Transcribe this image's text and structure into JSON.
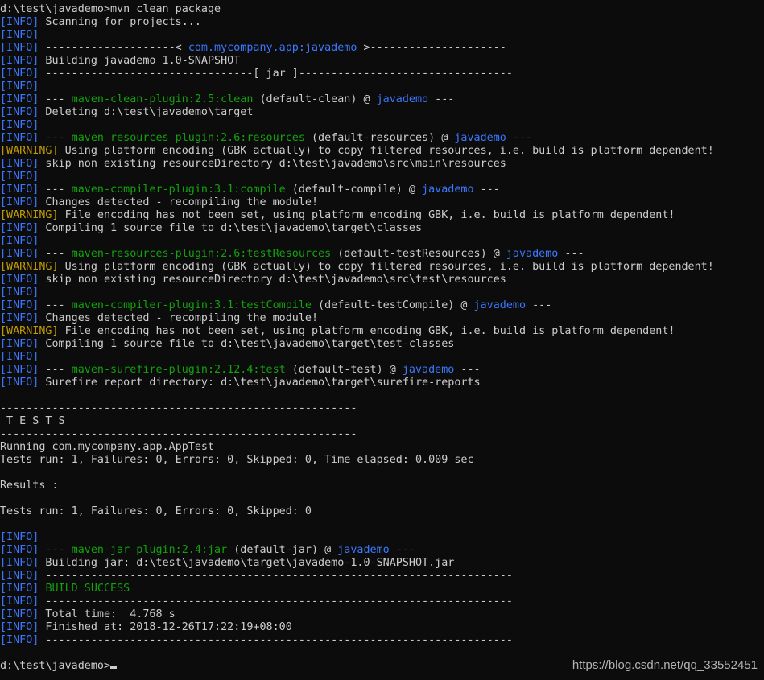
{
  "terminal": {
    "lines": [
      [
        {
          "t": "d:\\test\\javademo>mvn clean package",
          "c": "plain"
        }
      ],
      [
        {
          "t": "[INFO]",
          "c": "info"
        },
        {
          "t": " Scanning for projects...",
          "c": "plain"
        }
      ],
      [
        {
          "t": "[INFO]",
          "c": "info"
        }
      ],
      [
        {
          "t": "[INFO]",
          "c": "info"
        },
        {
          "t": " --------------------< ",
          "c": "plain"
        },
        {
          "t": "com.mycompany.app:javademo",
          "c": "project"
        },
        {
          "t": " >---------------------",
          "c": "plain"
        }
      ],
      [
        {
          "t": "[INFO]",
          "c": "info"
        },
        {
          "t": " Building javademo 1.0-SNAPSHOT",
          "c": "plain"
        }
      ],
      [
        {
          "t": "[INFO]",
          "c": "info"
        },
        {
          "t": " --------------------------------[ jar ]---------------------------------",
          "c": "plain"
        }
      ],
      [
        {
          "t": "[INFO]",
          "c": "info"
        }
      ],
      [
        {
          "t": "[INFO]",
          "c": "info"
        },
        {
          "t": " --- ",
          "c": "plain"
        },
        {
          "t": "maven-clean-plugin:2.5:clean",
          "c": "plugin"
        },
        {
          "t": " (default-clean) @ ",
          "c": "plain"
        },
        {
          "t": "javademo",
          "c": "project"
        },
        {
          "t": " ---",
          "c": "plain"
        }
      ],
      [
        {
          "t": "[INFO]",
          "c": "info"
        },
        {
          "t": " Deleting d:\\test\\javademo\\target",
          "c": "plain"
        }
      ],
      [
        {
          "t": "[INFO]",
          "c": "info"
        }
      ],
      [
        {
          "t": "[INFO]",
          "c": "info"
        },
        {
          "t": " --- ",
          "c": "plain"
        },
        {
          "t": "maven-resources-plugin:2.6:resources",
          "c": "plugin"
        },
        {
          "t": " (default-resources) @ ",
          "c": "plain"
        },
        {
          "t": "javademo",
          "c": "project"
        },
        {
          "t": " ---",
          "c": "plain"
        }
      ],
      [
        {
          "t": "[WARNING]",
          "c": "warning"
        },
        {
          "t": " Using platform encoding (GBK actually) to copy filtered resources, i.e. build is platform dependent!",
          "c": "plain"
        }
      ],
      [
        {
          "t": "[INFO]",
          "c": "info"
        },
        {
          "t": " skip non existing resourceDirectory d:\\test\\javademo\\src\\main\\resources",
          "c": "plain"
        }
      ],
      [
        {
          "t": "[INFO]",
          "c": "info"
        }
      ],
      [
        {
          "t": "[INFO]",
          "c": "info"
        },
        {
          "t": " --- ",
          "c": "plain"
        },
        {
          "t": "maven-compiler-plugin:3.1:compile",
          "c": "plugin"
        },
        {
          "t": " (default-compile) @ ",
          "c": "plain"
        },
        {
          "t": "javademo",
          "c": "project"
        },
        {
          "t": " ---",
          "c": "plain"
        }
      ],
      [
        {
          "t": "[INFO]",
          "c": "info"
        },
        {
          "t": " Changes detected - recompiling the module!",
          "c": "plain"
        }
      ],
      [
        {
          "t": "[WARNING]",
          "c": "warning"
        },
        {
          "t": " File encoding has not been set, using platform encoding GBK, i.e. build is platform dependent!",
          "c": "plain"
        }
      ],
      [
        {
          "t": "[INFO]",
          "c": "info"
        },
        {
          "t": " Compiling 1 source file to d:\\test\\javademo\\target\\classes",
          "c": "plain"
        }
      ],
      [
        {
          "t": "[INFO]",
          "c": "info"
        }
      ],
      [
        {
          "t": "[INFO]",
          "c": "info"
        },
        {
          "t": " --- ",
          "c": "plain"
        },
        {
          "t": "maven-resources-plugin:2.6:testResources",
          "c": "plugin"
        },
        {
          "t": " (default-testResources) @ ",
          "c": "plain"
        },
        {
          "t": "javademo",
          "c": "project"
        },
        {
          "t": " ---",
          "c": "plain"
        }
      ],
      [
        {
          "t": "[WARNING]",
          "c": "warning"
        },
        {
          "t": " Using platform encoding (GBK actually) to copy filtered resources, i.e. build is platform dependent!",
          "c": "plain"
        }
      ],
      [
        {
          "t": "[INFO]",
          "c": "info"
        },
        {
          "t": " skip non existing resourceDirectory d:\\test\\javademo\\src\\test\\resources",
          "c": "plain"
        }
      ],
      [
        {
          "t": "[INFO]",
          "c": "info"
        }
      ],
      [
        {
          "t": "[INFO]",
          "c": "info"
        },
        {
          "t": " --- ",
          "c": "plain"
        },
        {
          "t": "maven-compiler-plugin:3.1:testCompile",
          "c": "plugin"
        },
        {
          "t": " (default-testCompile) @ ",
          "c": "plain"
        },
        {
          "t": "javademo",
          "c": "project"
        },
        {
          "t": " ---",
          "c": "plain"
        }
      ],
      [
        {
          "t": "[INFO]",
          "c": "info"
        },
        {
          "t": " Changes detected - recompiling the module!",
          "c": "plain"
        }
      ],
      [
        {
          "t": "[WARNING]",
          "c": "warning"
        },
        {
          "t": " File encoding has not been set, using platform encoding GBK, i.e. build is platform dependent!",
          "c": "plain"
        }
      ],
      [
        {
          "t": "[INFO]",
          "c": "info"
        },
        {
          "t": " Compiling 1 source file to d:\\test\\javademo\\target\\test-classes",
          "c": "plain"
        }
      ],
      [
        {
          "t": "[INFO]",
          "c": "info"
        }
      ],
      [
        {
          "t": "[INFO]",
          "c": "info"
        },
        {
          "t": " --- ",
          "c": "plain"
        },
        {
          "t": "maven-surefire-plugin:2.12.4:test",
          "c": "plugin"
        },
        {
          "t": " (default-test) @ ",
          "c": "plain"
        },
        {
          "t": "javademo",
          "c": "project"
        },
        {
          "t": " ---",
          "c": "plain"
        }
      ],
      [
        {
          "t": "[INFO]",
          "c": "info"
        },
        {
          "t": " Surefire report directory: d:\\test\\javademo\\target\\surefire-reports",
          "c": "plain"
        }
      ],
      [],
      [
        {
          "t": "-------------------------------------------------------",
          "c": "plain"
        }
      ],
      [
        {
          "t": " T E S T S",
          "c": "plain"
        }
      ],
      [
        {
          "t": "-------------------------------------------------------",
          "c": "plain"
        }
      ],
      [
        {
          "t": "Running com.mycompany.app.AppTest",
          "c": "plain"
        }
      ],
      [
        {
          "t": "Tests run: 1, Failures: 0, Errors: 0, Skipped: 0, Time elapsed: 0.009 sec",
          "c": "plain"
        }
      ],
      [],
      [
        {
          "t": "Results :",
          "c": "plain"
        }
      ],
      [],
      [
        {
          "t": "Tests run: 1, Failures: 0, Errors: 0, Skipped: 0",
          "c": "plain"
        }
      ],
      [],
      [
        {
          "t": "[INFO]",
          "c": "info"
        }
      ],
      [
        {
          "t": "[INFO]",
          "c": "info"
        },
        {
          "t": " --- ",
          "c": "plain"
        },
        {
          "t": "maven-jar-plugin:2.4:jar",
          "c": "plugin"
        },
        {
          "t": " (default-jar) @ ",
          "c": "plain"
        },
        {
          "t": "javademo",
          "c": "project"
        },
        {
          "t": " ---",
          "c": "plain"
        }
      ],
      [
        {
          "t": "[INFO]",
          "c": "info"
        },
        {
          "t": " Building jar: d:\\test\\javademo\\target\\javademo-1.0-SNAPSHOT.jar",
          "c": "plain"
        }
      ],
      [
        {
          "t": "[INFO]",
          "c": "info"
        },
        {
          "t": " ------------------------------------------------------------------------",
          "c": "plain"
        }
      ],
      [
        {
          "t": "[INFO]",
          "c": "info"
        },
        {
          "t": " ",
          "c": "plain"
        },
        {
          "t": "BUILD SUCCESS",
          "c": "success"
        }
      ],
      [
        {
          "t": "[INFO]",
          "c": "info"
        },
        {
          "t": " ------------------------------------------------------------------------",
          "c": "plain"
        }
      ],
      [
        {
          "t": "[INFO]",
          "c": "info"
        },
        {
          "t": " Total time:  4.768 s",
          "c": "plain"
        }
      ],
      [
        {
          "t": "[INFO]",
          "c": "info"
        },
        {
          "t": " Finished at: 2018-12-26T17:22:19+08:00",
          "c": "plain"
        }
      ],
      [
        {
          "t": "[INFO]",
          "c": "info"
        },
        {
          "t": " ------------------------------------------------------------------------",
          "c": "plain"
        }
      ],
      [],
      [
        {
          "t": "d:\\test\\javademo>",
          "c": "plain"
        }
      ]
    ]
  },
  "watermark": "https://blog.csdn.net/qq_33552451",
  "colors": {
    "background": "#0c0c0c",
    "text": "#cccccc",
    "info": "#3b78ff",
    "warning": "#c19c00",
    "plugin": "#13a10e"
  }
}
